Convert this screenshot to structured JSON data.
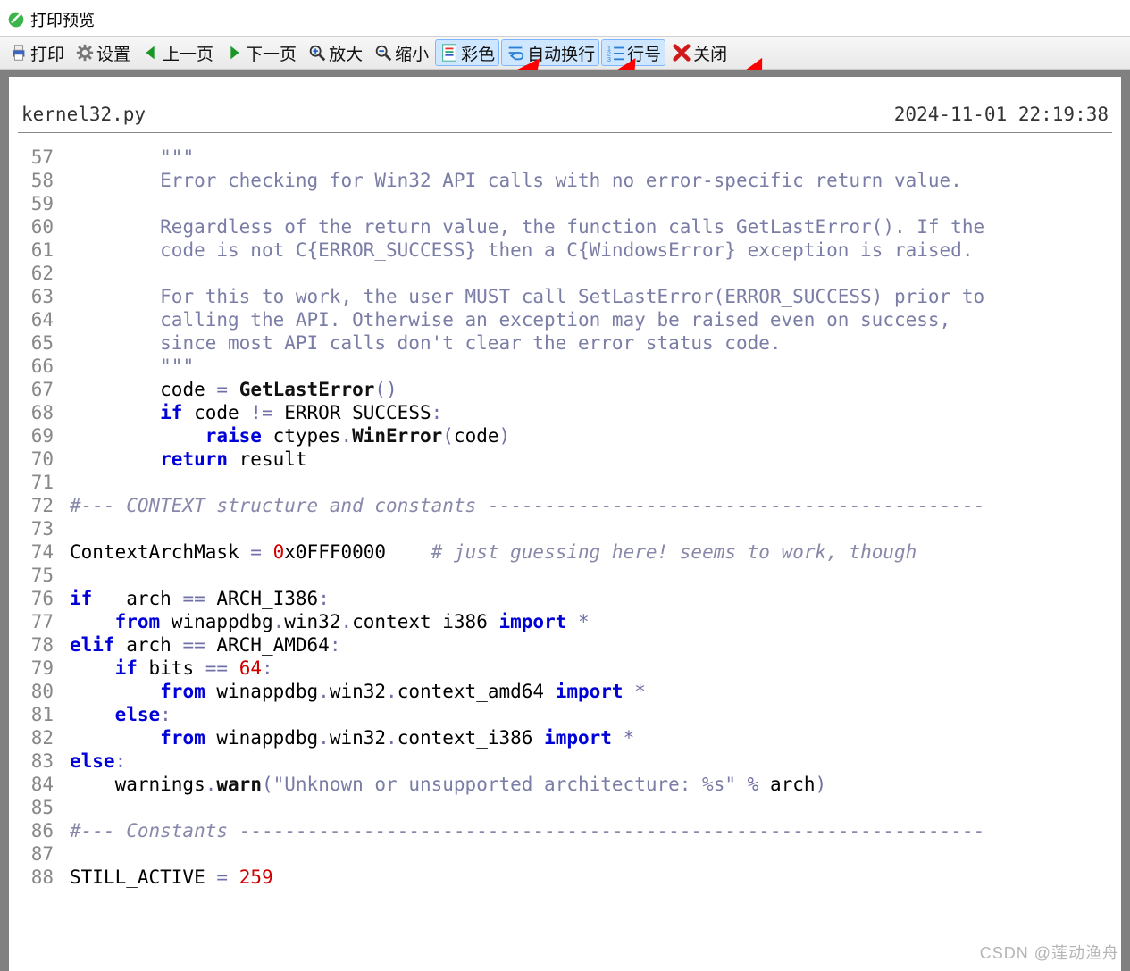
{
  "window": {
    "title": "打印预览"
  },
  "toolbar": {
    "print": {
      "label": "打印"
    },
    "setup": {
      "label": "设置"
    },
    "prev": {
      "label": "上一页"
    },
    "next": {
      "label": "下一页"
    },
    "zoomin": {
      "label": "放大"
    },
    "zoomout": {
      "label": "缩小"
    },
    "color": {
      "label": "彩色"
    },
    "wrap": {
      "label": "自动换行"
    },
    "lineno": {
      "label": "行号"
    },
    "close": {
      "label": "关闭"
    }
  },
  "page_header": {
    "filename": "kernel32.py",
    "timestamp": "2024-11-01 22:19:38"
  },
  "code": {
    "first_line": 57,
    "lines": [
      {
        "n": 57,
        "t": "        ",
        "r": [
          [
            "str",
            "\"\"\""
          ]
        ]
      },
      {
        "n": 58,
        "t": "        ",
        "r": [
          [
            "str",
            "Error checking for Win32 API calls with no error-specific return value."
          ]
        ]
      },
      {
        "n": 59,
        "t": "",
        "r": []
      },
      {
        "n": 60,
        "t": "        ",
        "r": [
          [
            "str",
            "Regardless of the return value, the function calls GetLastError(). If the"
          ]
        ]
      },
      {
        "n": 61,
        "t": "        ",
        "r": [
          [
            "str",
            "code is not C{ERROR_SUCCESS} then a C{WindowsError} exception is raised."
          ]
        ]
      },
      {
        "n": 62,
        "t": "",
        "r": []
      },
      {
        "n": 63,
        "t": "        ",
        "r": [
          [
            "str",
            "For this to work, the user MUST call SetLastError(ERROR_SUCCESS) prior to"
          ]
        ]
      },
      {
        "n": 64,
        "t": "        ",
        "r": [
          [
            "str",
            "calling the API. Otherwise an exception may be raised even on success,"
          ]
        ]
      },
      {
        "n": 65,
        "t": "        ",
        "r": [
          [
            "str",
            "since most API calls don't clear the error status code."
          ]
        ]
      },
      {
        "n": 66,
        "t": "        ",
        "r": [
          [
            "str",
            "\"\"\""
          ]
        ]
      },
      {
        "n": 67,
        "t": "        ",
        "r": [
          [
            "",
            "code "
          ],
          [
            "op",
            "="
          ],
          [
            "",
            " "
          ],
          [
            "fn",
            "GetLastError"
          ],
          [
            "op",
            "()"
          ]
        ]
      },
      {
        "n": 68,
        "t": "        ",
        "r": [
          [
            "kw",
            "if"
          ],
          [
            "",
            " code "
          ],
          [
            "op",
            "!="
          ],
          [
            "",
            " ERROR_SUCCESS"
          ],
          [
            "op",
            ":"
          ]
        ]
      },
      {
        "n": 69,
        "t": "            ",
        "r": [
          [
            "kw",
            "raise"
          ],
          [
            "",
            " ctypes"
          ],
          [
            "op",
            "."
          ],
          [
            "fn",
            "WinError"
          ],
          [
            "op",
            "("
          ],
          [
            "",
            "code"
          ],
          [
            "op",
            ")"
          ]
        ]
      },
      {
        "n": 70,
        "t": "        ",
        "r": [
          [
            "kw",
            "return"
          ],
          [
            "",
            " result"
          ]
        ]
      },
      {
        "n": 71,
        "t": "",
        "r": []
      },
      {
        "n": 72,
        "t": "",
        "r": [
          [
            "cm",
            "#--- CONTEXT structure and constants "
          ],
          [
            "cmdash",
            "--------------------------------------------"
          ]
        ]
      },
      {
        "n": 73,
        "t": "",
        "r": []
      },
      {
        "n": 74,
        "t": "",
        "r": [
          [
            "",
            "ContextArchMask "
          ],
          [
            "op",
            "="
          ],
          [
            "",
            " "
          ],
          [
            "num",
            "0"
          ],
          [
            "",
            "x0FFF0000    "
          ],
          [
            "cm",
            "# just guessing here! seems to work, though"
          ]
        ]
      },
      {
        "n": 75,
        "t": "",
        "r": []
      },
      {
        "n": 76,
        "t": "",
        "r": [
          [
            "kw",
            "if"
          ],
          [
            "",
            "   arch "
          ],
          [
            "op",
            "=="
          ],
          [
            "",
            " ARCH_I386"
          ],
          [
            "op",
            ":"
          ]
        ]
      },
      {
        "n": 77,
        "t": "    ",
        "r": [
          [
            "kw",
            "from"
          ],
          [
            "",
            " winappdbg"
          ],
          [
            "op",
            "."
          ],
          [
            "",
            "win32"
          ],
          [
            "op",
            "."
          ],
          [
            "",
            "context_i386 "
          ],
          [
            "kw",
            "import"
          ],
          [
            "",
            " "
          ],
          [
            "op",
            "*"
          ]
        ]
      },
      {
        "n": 78,
        "t": "",
        "r": [
          [
            "kw",
            "elif"
          ],
          [
            "",
            " arch "
          ],
          [
            "op",
            "=="
          ],
          [
            "",
            " ARCH_AMD64"
          ],
          [
            "op",
            ":"
          ]
        ]
      },
      {
        "n": 79,
        "t": "    ",
        "r": [
          [
            "kw",
            "if"
          ],
          [
            "",
            " bits "
          ],
          [
            "op",
            "=="
          ],
          [
            "",
            " "
          ],
          [
            "num",
            "64"
          ],
          [
            "op",
            ":"
          ]
        ]
      },
      {
        "n": 80,
        "t": "        ",
        "r": [
          [
            "kw",
            "from"
          ],
          [
            "",
            " winappdbg"
          ],
          [
            "op",
            "."
          ],
          [
            "",
            "win32"
          ],
          [
            "op",
            "."
          ],
          [
            "",
            "context_amd64 "
          ],
          [
            "kw",
            "import"
          ],
          [
            "",
            " "
          ],
          [
            "op",
            "*"
          ]
        ]
      },
      {
        "n": 81,
        "t": "    ",
        "r": [
          [
            "kw",
            "else"
          ],
          [
            "op",
            ":"
          ]
        ]
      },
      {
        "n": 82,
        "t": "        ",
        "r": [
          [
            "kw",
            "from"
          ],
          [
            "",
            " winappdbg"
          ],
          [
            "op",
            "."
          ],
          [
            "",
            "win32"
          ],
          [
            "op",
            "."
          ],
          [
            "",
            "context_i386 "
          ],
          [
            "kw",
            "import"
          ],
          [
            "",
            " "
          ],
          [
            "op",
            "*"
          ]
        ]
      },
      {
        "n": 83,
        "t": "",
        "r": [
          [
            "kw",
            "else"
          ],
          [
            "op",
            ":"
          ]
        ]
      },
      {
        "n": 84,
        "t": "    ",
        "r": [
          [
            "",
            "warnings"
          ],
          [
            "op",
            "."
          ],
          [
            "fn",
            "warn"
          ],
          [
            "op",
            "("
          ],
          [
            "str",
            "\"Unknown or unsupported architecture: %s\""
          ],
          [
            "",
            " "
          ],
          [
            "op",
            "%"
          ],
          [
            "",
            " arch"
          ],
          [
            "op",
            ")"
          ]
        ]
      },
      {
        "n": 85,
        "t": "",
        "r": []
      },
      {
        "n": 86,
        "t": "",
        "r": [
          [
            "cm",
            "#--- Constants "
          ],
          [
            "cmdash",
            "------------------------------------------------------------------"
          ]
        ]
      },
      {
        "n": 87,
        "t": "",
        "r": []
      },
      {
        "n": 88,
        "t": "",
        "r": [
          [
            "",
            "STILL_ACTIVE "
          ],
          [
            "op",
            "="
          ],
          [
            "",
            " "
          ],
          [
            "num",
            "259"
          ]
        ]
      }
    ]
  },
  "watermark": "CSDN @莲动渔舟"
}
